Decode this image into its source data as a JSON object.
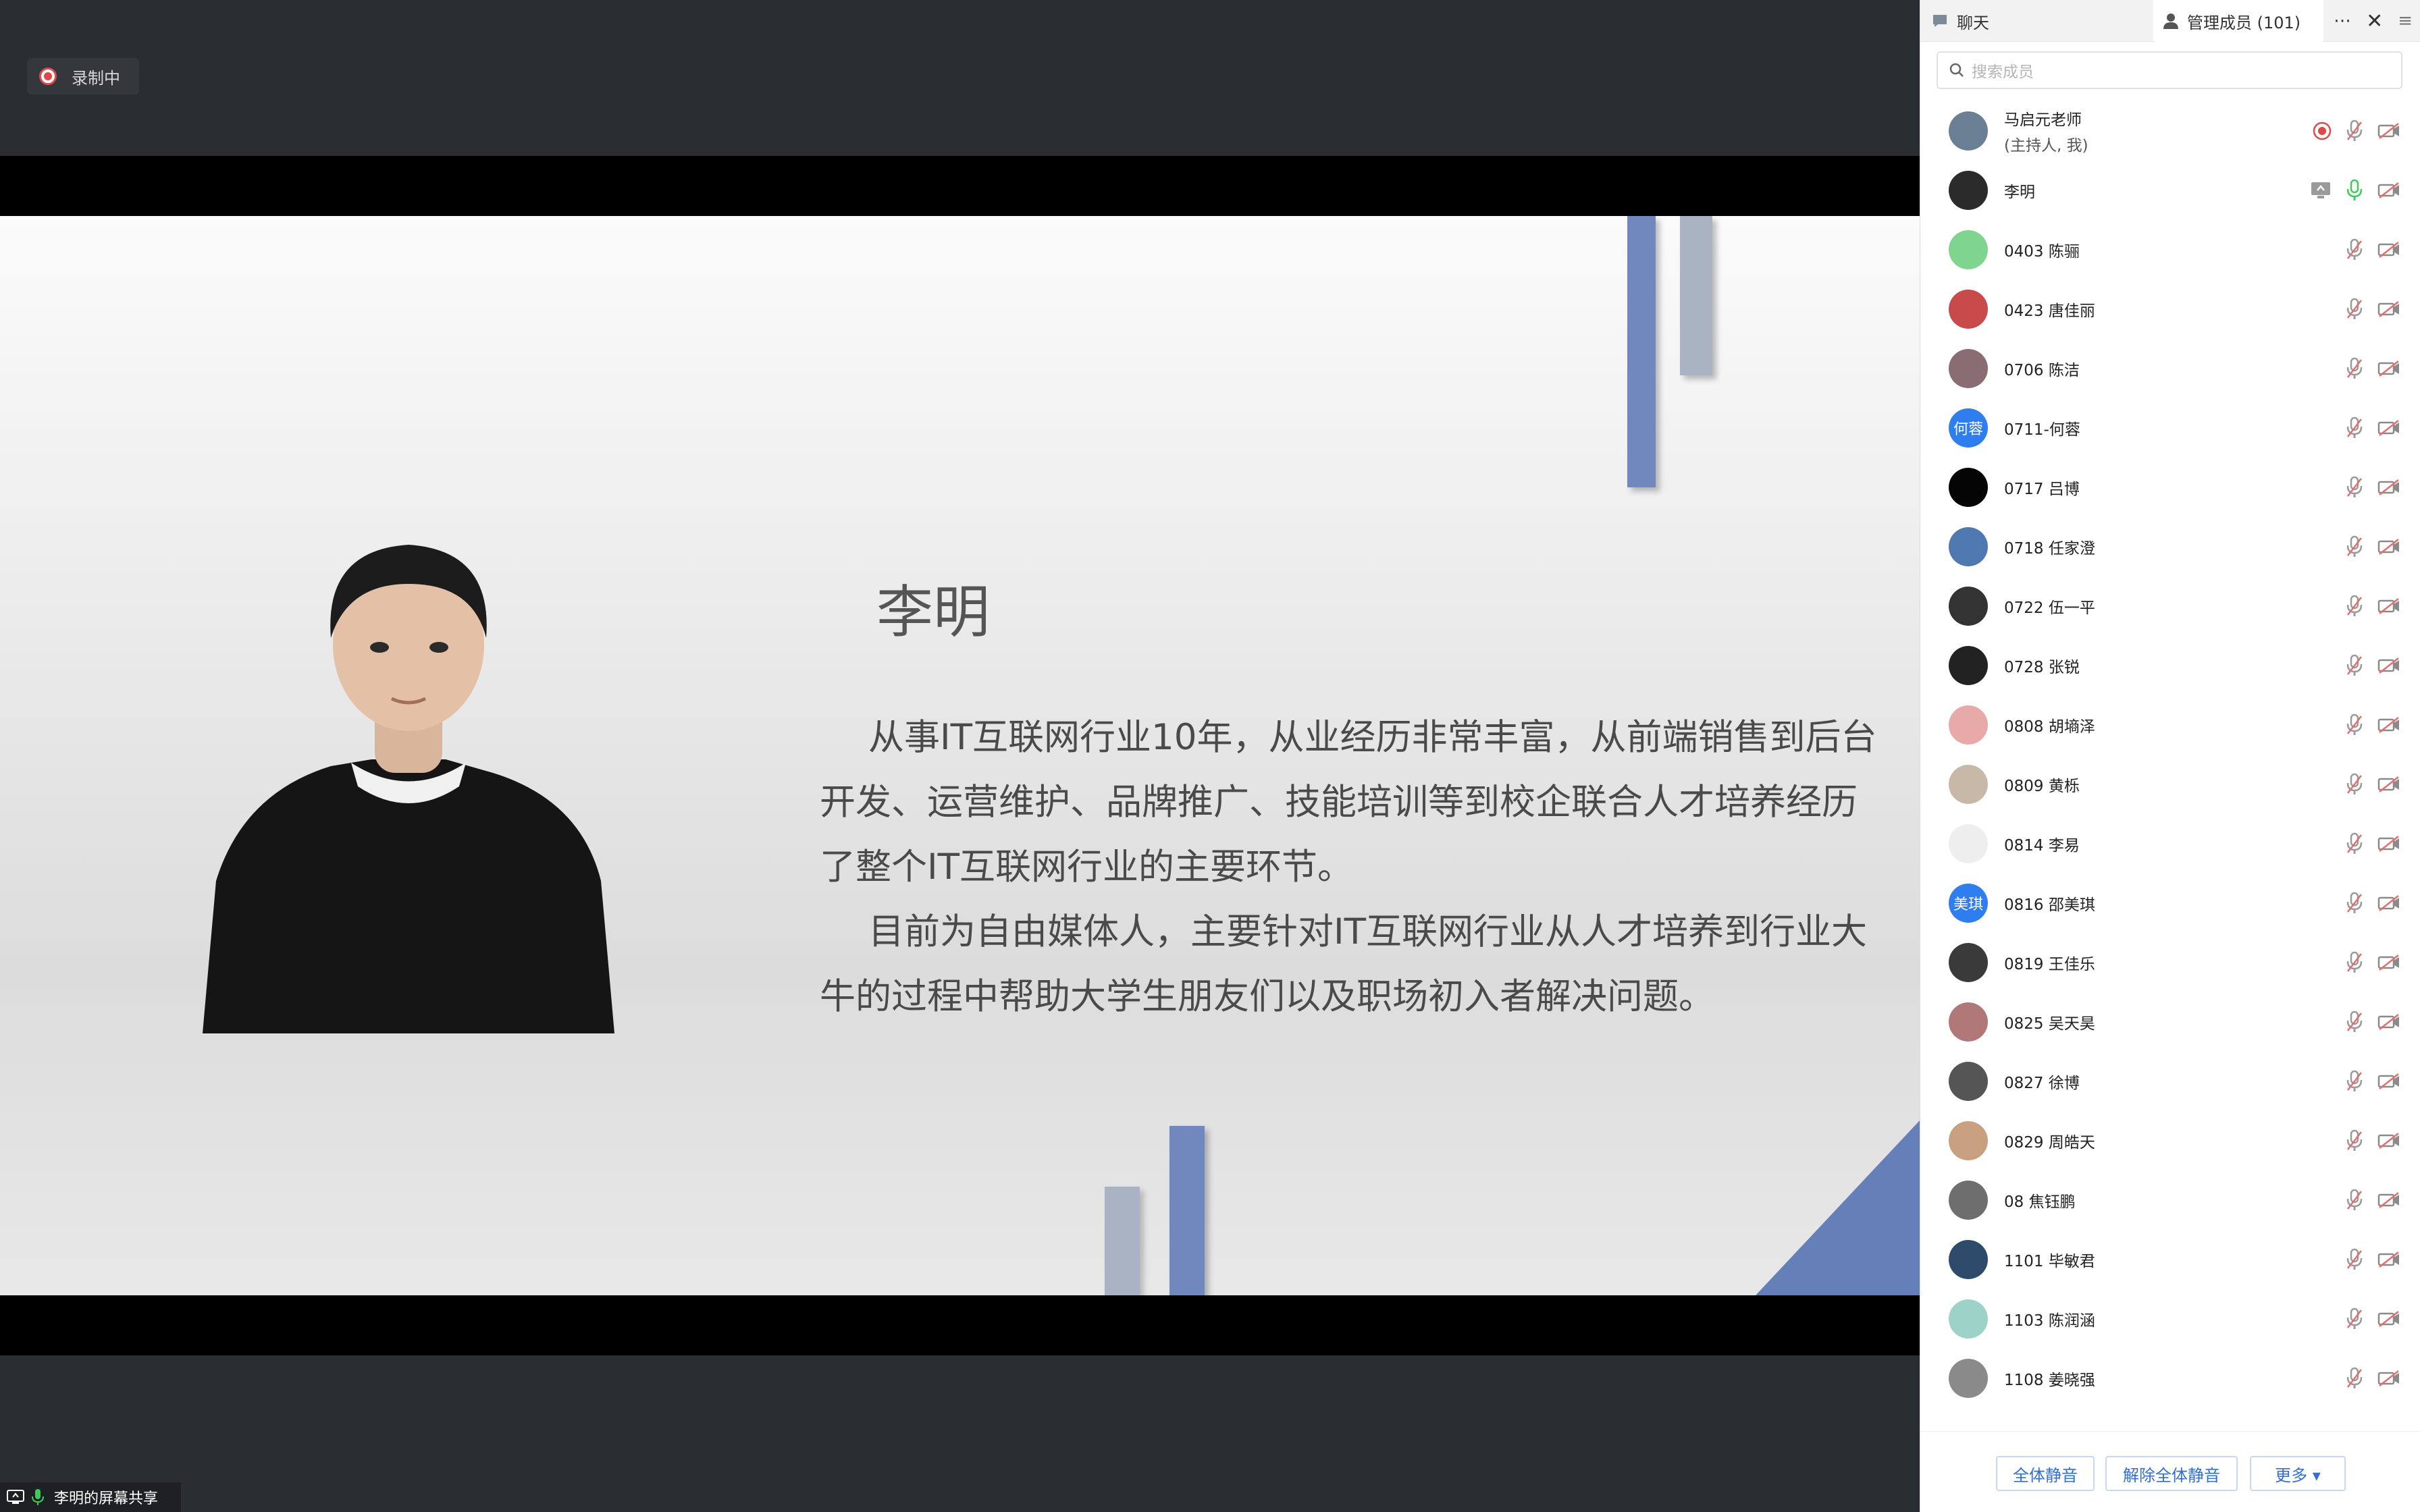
{
  "recording": {
    "label": "录制中"
  },
  "slide": {
    "name": "李明",
    "paragraph1": "从事IT互联网行业10年，从业经历非常丰富，从前端销售到后台开发、运营维护、品牌推广、技能培训等到校企联合人才培养经历了整个IT互联网行业的主要环节。",
    "paragraph2": "目前为自由媒体人，主要针对IT互联网行业从人才培养到行业大牛的过程中帮助大学生朋友们以及职场初入者解决问题。"
  },
  "screen_share_label": "李明的屏幕共享",
  "panel": {
    "tab_chat": "聊天",
    "tab_members": "管理成员 (101)",
    "search_placeholder": "搜索成员",
    "members": [
      {
        "name": "马启元老师",
        "sub": "(主持人, 我)"
      },
      {
        "name": "李明"
      },
      {
        "name": "0403 陈骊"
      },
      {
        "name": "0423 唐佳丽"
      },
      {
        "name": "0706 陈洁"
      },
      {
        "name": "0711-何蓉",
        "avatar_text": "何蓉"
      },
      {
        "name": "0717 吕博"
      },
      {
        "name": "0718 任家澄"
      },
      {
        "name": "0722 伍一平"
      },
      {
        "name": "0728 张锐"
      },
      {
        "name": "0808 胡墒泽"
      },
      {
        "name": "0809 黄栎"
      },
      {
        "name": "0814 李易"
      },
      {
        "name": "0816 邵美琪",
        "avatar_text": "美琪"
      },
      {
        "name": "0819 王佳乐"
      },
      {
        "name": "0825 吴天昊"
      },
      {
        "name": "0827 徐博"
      },
      {
        "name": "0829 周皓天"
      },
      {
        "name": "08 焦钰鹏"
      },
      {
        "name": "1101 毕敏君"
      },
      {
        "name": "1103 陈润涵"
      },
      {
        "name": "1108 姜晓强"
      }
    ],
    "footer": {
      "mute_all": "全体静音",
      "unmute_all": "解除全体静音",
      "more": "更多 ▾"
    }
  },
  "colors": {
    "accent": "#2f6fd6",
    "slide_deco": "#6f86b8",
    "slide_deco_light": "#a9b3c4"
  }
}
